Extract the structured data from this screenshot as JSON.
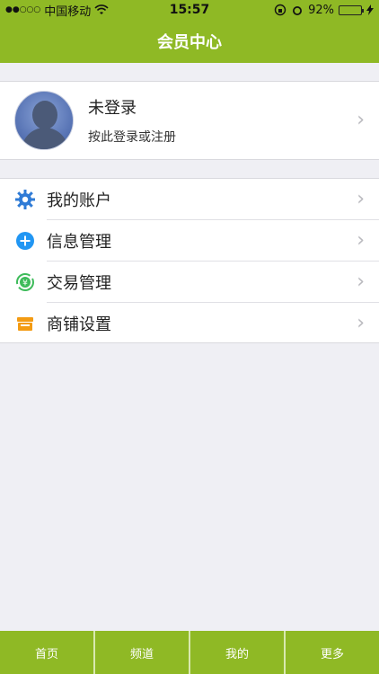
{
  "status_bar": {
    "signal_dots": "●●○○○",
    "carrier": "中国移动",
    "time": "15:57",
    "battery": "92%",
    "battery_fill": 0.92
  },
  "header": {
    "title": "会员中心"
  },
  "profile": {
    "title": "未登录",
    "subtitle": "按此登录或注册"
  },
  "menu": {
    "items": [
      {
        "label": "我的账户",
        "icon": "gear-icon"
      },
      {
        "label": "信息管理",
        "icon": "plus-circle-icon"
      },
      {
        "label": "交易管理",
        "icon": "yen-refresh-icon"
      },
      {
        "label": "商铺设置",
        "icon": "store-icon"
      }
    ]
  },
  "tabbar": {
    "tabs": [
      {
        "label": "首页"
      },
      {
        "label": "频道"
      },
      {
        "label": "我的"
      },
      {
        "label": "更多"
      }
    ]
  },
  "colors": {
    "brand": "#8fb925",
    "gear": "#2f7bd6",
    "plus": "#2196f3",
    "yen": "#3dbb5a",
    "store": "#f39b13"
  }
}
